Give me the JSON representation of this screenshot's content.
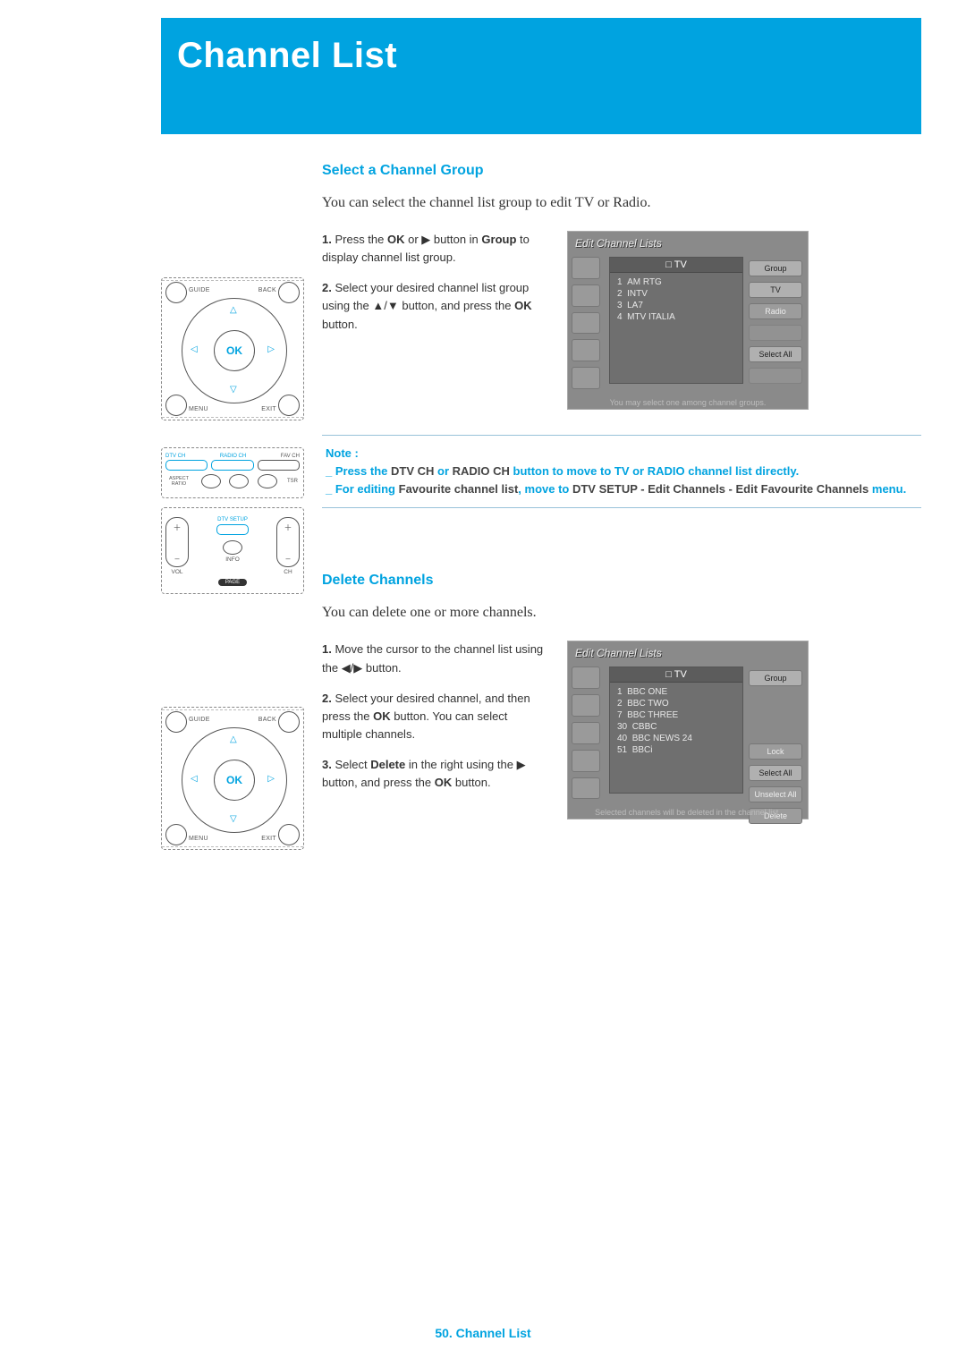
{
  "page_title": "Channel List",
  "footer": {
    "page_num": "50.",
    "label": "Channel List"
  },
  "section1": {
    "heading": "Select a Channel Group",
    "intro": "You can select the channel list group to edit TV or Radio.",
    "steps": {
      "s1_n": "1.",
      "s1_a": "Press the ",
      "s1_ok": "OK",
      "s1_b": " or ",
      "s1_tri": "▶",
      "s1_c": " button in ",
      "s1_group": "Group",
      "s1_d": " to display channel list group.",
      "s2_n": "2.",
      "s2_a": "Select your desired channel list group using the ",
      "s2_tri": "▲/▼",
      "s2_b": " button, and press the ",
      "s2_ok": "OK",
      "s2_c": " button."
    },
    "shot": {
      "title": "Edit Channel Lists",
      "list_head": "□  TV",
      "items": [
        {
          "num": "1",
          "name": "AM RTG"
        },
        {
          "num": "2",
          "name": "INTV"
        },
        {
          "num": "3",
          "name": "LA7"
        },
        {
          "num": "4",
          "name": "MTV ITALIA"
        }
      ],
      "buttons": [
        {
          "label": "Group",
          "cls": "sel"
        },
        {
          "label": "TV",
          "cls": "sel"
        },
        {
          "label": "Radio",
          "cls": ""
        },
        {
          "label": "",
          "cls": "dim"
        },
        {
          "label": "Select All",
          "cls": "sel"
        },
        {
          "label": "",
          "cls": "dim"
        }
      ],
      "hint": "You may select one among channel groups."
    }
  },
  "note": {
    "label": "Note :",
    "line1_a": "_  Press the ",
    "line1_b": "DTV CH",
    "line1_c": " or ",
    "line1_d": "RADIO CH",
    "line1_e": " button to move to TV or RADIO channel list directly.",
    "line2_a": "_  For editing ",
    "line2_b": "Favourite channel list",
    "line2_c": ", move to ",
    "line2_d": "DTV SETUP - Edit Channels - Edit Favourite Channels",
    "line2_e": " menu."
  },
  "remote": {
    "ok": "OK",
    "labels": {
      "tl": "GUIDE",
      "tr": "BACK",
      "bl": "MENU",
      "br": "EXIT"
    },
    "panel_top": {
      "c1": "DTV CH",
      "c2": "RADIO CH",
      "c3": "FAV CH",
      "r2a": "ASPECT RATIO",
      "r2c": "TSR"
    },
    "panel_bot": {
      "setup": "DTV SETUP",
      "vol": "VOL",
      "ch": "CH",
      "info": "INFO",
      "page": "PAGE",
      "plus": "＋",
      "minus": "–"
    }
  },
  "section2": {
    "heading": "Delete Channels",
    "intro": "You can delete one or more channels.",
    "steps": {
      "s1_n": "1.",
      "s1_a": "Move the cursor to the channel list using the ",
      "s1_tri": "◀/▶",
      "s1_b": " button.",
      "s2_n": "2.",
      "s2_a": "Select your desired channel, and then press the ",
      "s2_ok": "OK",
      "s2_b": " button. You can select multiple channels.",
      "s3_n": "3.",
      "s3_a": "Select ",
      "s3_del": "Delete",
      "s3_b": " in the right using the ",
      "s3_tri": "▶",
      "s3_c": " button, and press the ",
      "s3_ok": "OK",
      "s3_d": " button."
    },
    "shot": {
      "title": "Edit Channel Lists",
      "list_head": "□  TV",
      "items": [
        {
          "num": "1",
          "name": "BBC ONE"
        },
        {
          "num": "2",
          "name": "BBC TWO"
        },
        {
          "num": "7",
          "name": "BBC THREE"
        },
        {
          "num": "30",
          "name": "CBBC"
        },
        {
          "num": "40",
          "name": "BBC NEWS 24"
        },
        {
          "num": "51",
          "name": "BBCi"
        }
      ],
      "buttons": [
        {
          "label": "Group",
          "cls": "sel"
        },
        {
          "label": "Lock",
          "cls": ""
        },
        {
          "label": "Select All",
          "cls": "sel"
        },
        {
          "label": "Unselect All",
          "cls": ""
        },
        {
          "label": "Delete",
          "cls": ""
        }
      ],
      "hint": "Selected channels will be deleted in the channel list."
    }
  }
}
